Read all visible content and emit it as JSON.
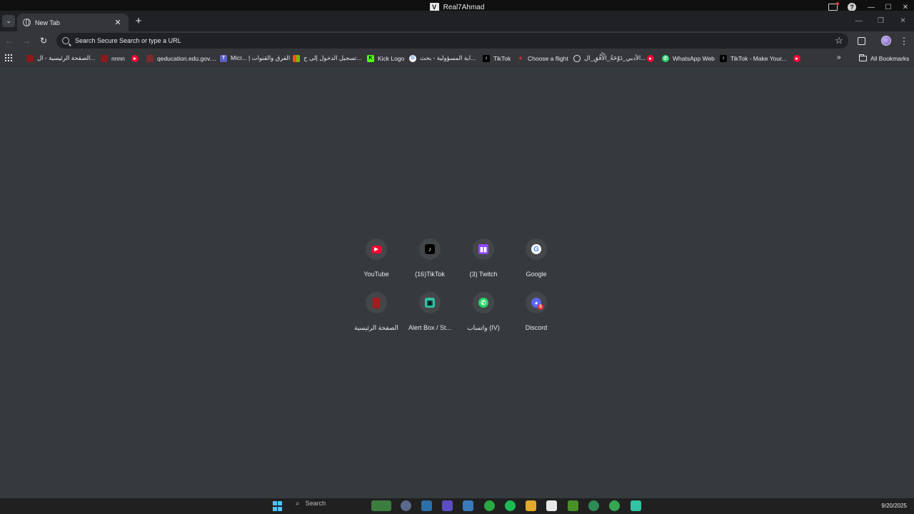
{
  "os": {
    "window_title": "Real7Ahmad",
    "app_logo_letter": "V"
  },
  "browser": {
    "tab": {
      "title": "New Tab"
    },
    "new_tab_symbol": "+",
    "close_symbol": "✕",
    "omnibox_placeholder": "Search Secure Search or type a URL"
  },
  "bookmarks": {
    "items": [
      {
        "label": "الصفحة الرئيسية - ال...",
        "icon": "red-logo-icon"
      },
      {
        "label": "nnnn",
        "icon": "red-logo-icon"
      },
      {
        "label": "",
        "icon": "youtube-icon"
      },
      {
        "label": "qeducation.edu.gov....",
        "icon": "qeducation-icon"
      },
      {
        "label": "Micr... | الفرق والقنوات",
        "icon": "teams-icon"
      },
      {
        "label": "تسجيل الدخول إلى ح...",
        "icon": "microsoft-icon"
      },
      {
        "label": "Kick Logo",
        "icon": "kick-icon"
      },
      {
        "label": "اية المسؤولية - بحث...",
        "icon": "google-icon"
      },
      {
        "label": "TikTok",
        "icon": "tiktok-icon"
      },
      {
        "label": "Choose a flight",
        "icon": "flight-icon"
      },
      {
        "label": "الأدبي_دَوْحَةُ_الْأُفُقِ_ال...",
        "icon": "globe-icon"
      },
      {
        "label": "",
        "icon": "youtube-icon"
      },
      {
        "label": "WhatsApp Web",
        "icon": "whatsapp-icon"
      },
      {
        "label": "TikTok - Make Your...",
        "icon": "tiktok-icon"
      },
      {
        "label": "",
        "icon": "youtube-icon"
      }
    ],
    "more_symbol": "»",
    "all_bookmarks_label": "All Bookmarks"
  },
  "shortcuts": [
    {
      "label": "YouTube",
      "icon": "youtube-icon"
    },
    {
      "label": "(16)TikTok",
      "icon": "tiktok-icon"
    },
    {
      "label": "(3) Twitch",
      "icon": "twitch-icon"
    },
    {
      "label": "Google",
      "icon": "google-icon"
    },
    {
      "label": "الصفحة الرئيسية",
      "icon": "red-logo-icon"
    },
    {
      "label": "Alert Box / St...",
      "icon": "streamlabs-icon"
    },
    {
      "label": "واتساب (IV)",
      "icon": "whatsapp-icon"
    },
    {
      "label": "Discord",
      "icon": "discord-icon"
    }
  ],
  "taskbar": {
    "search_placeholder": "Search",
    "date": "9/20/2025"
  },
  "colors": {
    "page_bg": "#353a3d",
    "youtube_red": "#ff0033",
    "twitch_purple": "#9146ff",
    "whatsapp_green": "#25d366",
    "discord_blurple": "#5865f2",
    "streamlabs_teal": "#31c3a2"
  }
}
